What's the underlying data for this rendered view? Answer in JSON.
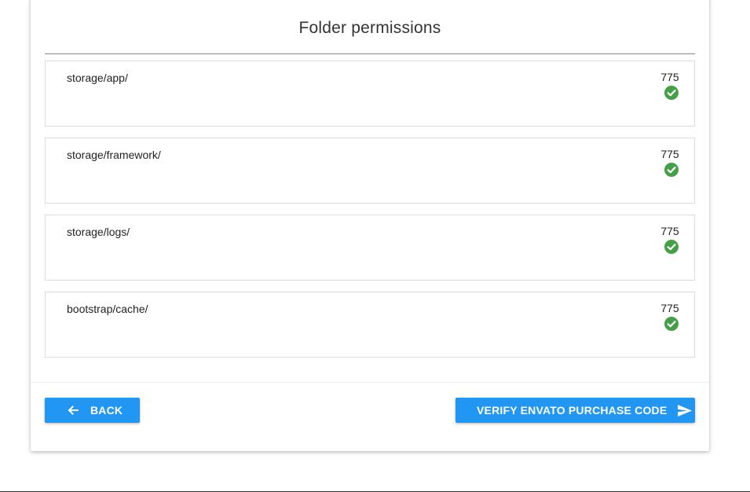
{
  "page": {
    "title": "Folder permissions"
  },
  "permissions": [
    {
      "path": "storage/app/",
      "value": "775",
      "status": "ok"
    },
    {
      "path": "storage/framework/",
      "value": "775",
      "status": "ok"
    },
    {
      "path": "storage/logs/",
      "value": "775",
      "status": "ok"
    },
    {
      "path": "bootstrap/cache/",
      "value": "775",
      "status": "ok"
    }
  ],
  "actions": {
    "back_label": "BACK",
    "verify_label": "VERIFY ENVATO PURCHASE CODE"
  },
  "icons": {
    "back": "arrow-left-icon",
    "verify": "send-icon",
    "status_ok": "check-circle-icon"
  },
  "colors": {
    "primary": "#2196f3",
    "success": "#43a047"
  }
}
